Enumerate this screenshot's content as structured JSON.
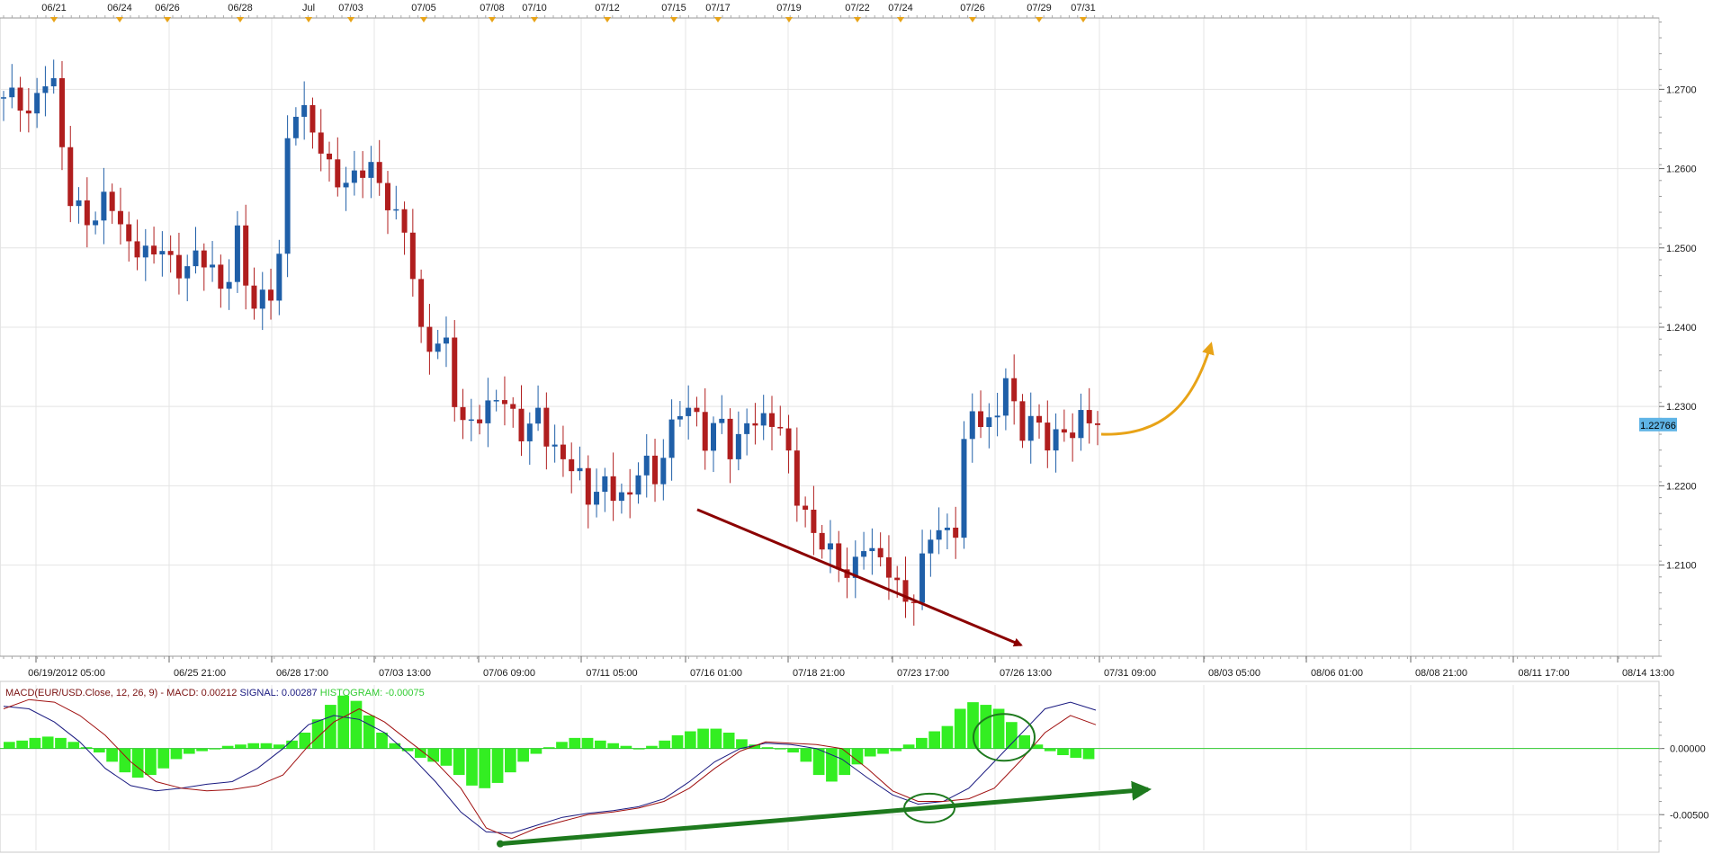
{
  "chart_data": [
    {
      "type": "candlestick",
      "instrument": "EUR/USD",
      "top_date_labels": [
        "06/21",
        "06/24",
        "06/26",
        "06/28",
        "Jul",
        "07/03",
        "07/05",
        "07/08",
        "07/10",
        "07/12",
        "07/15",
        "07/17",
        "07/19",
        "07/22",
        "07/24",
        "07/26",
        "07/29",
        "07/31"
      ],
      "bottom_time_labels": [
        "06/19/2012 05:00",
        "06/25 21:00",
        "06/28 17:00",
        "07/03 13:00",
        "07/06 09:00",
        "07/11 05:00",
        "07/16 01:00",
        "07/18 21:00",
        "07/23 17:00",
        "07/26 13:00",
        "07/31 09:00",
        "08/03 05:00",
        "08/06 01:00",
        "08/08 21:00",
        "08/11 17:00",
        "08/14 13:00"
      ],
      "y_ticks": [
        "1.2100",
        "1.2200",
        "1.2300",
        "1.2400",
        "1.2500",
        "1.2600",
        "1.2700"
      ],
      "ylim": [
        1.1985,
        1.279
      ],
      "last_price_label": "1.22766",
      "last_price": 1.22766,
      "colors": {
        "up": "#1f5fa8",
        "down": "#b01e1e",
        "grid": "#e4e4e4"
      },
      "close_path": [
        1.269,
        1.2695,
        1.266,
        1.2718,
        1.27,
        1.256,
        1.2545,
        1.253,
        1.2578,
        1.252,
        1.25,
        1.249,
        1.2505,
        1.2475,
        1.247,
        1.2498,
        1.247,
        1.244,
        1.252,
        1.242,
        1.244,
        1.245,
        1.268,
        1.2672,
        1.264,
        1.26,
        1.2578,
        1.259,
        1.2608,
        1.2575,
        1.254,
        1.252,
        1.239,
        1.2375,
        1.238,
        1.227,
        1.2285,
        1.229,
        1.232,
        1.229,
        1.226,
        1.2295,
        1.2245,
        1.2235,
        1.222,
        1.218,
        1.2205,
        1.219,
        1.218,
        1.224,
        1.2205,
        1.226,
        1.23,
        1.2295,
        1.225,
        1.2292,
        1.223,
        1.2285,
        1.2278,
        1.2285,
        1.226,
        1.218,
        1.2145,
        1.2125,
        1.2105,
        1.208,
        1.213,
        1.211,
        1.2095,
        1.2055,
        1.206,
        1.214,
        1.2145,
        1.213,
        1.2295,
        1.2285,
        1.227,
        1.2345,
        1.226,
        1.229,
        1.2255,
        1.2265,
        1.2268,
        1.229,
        1.2276
      ],
      "annotations": [
        {
          "type": "arrow",
          "color": "#8b0000",
          "from": [
            "07/12",
            1.217
          ],
          "to": [
            "07/27",
            1.199
          ]
        },
        {
          "type": "curved-arrow",
          "color": "#e8a317",
          "from": [
            "07/31",
            1.2265
          ],
          "to": [
            "08/03",
            1.239
          ]
        }
      ]
    },
    {
      "type": "macd",
      "label_prefix": "MACD(EUR/USD.Close, 12, 26, 9)",
      "macd_label": "MACD: 0.00212",
      "signal_label": "SIGNAL: 0.00287",
      "histogram_label": "HISTOGRAM: -0.00075",
      "y_ticks": [
        "0.00000",
        "-0.00500"
      ],
      "ylim": [
        -0.0077,
        0.0048
      ],
      "colors": {
        "macd": "#a01010",
        "signal": "#1a1a80",
        "histogram": "#33ee22",
        "zero_line": "#33cc33",
        "label_macd": "#7a1010",
        "label_signal": "#1a1a80",
        "label_hist": "#33cc33"
      },
      "histogram": [
        0.0005,
        0.0006,
        0.0008,
        0.0009,
        0.0008,
        0.0005,
        0.0001,
        -0.0003,
        -0.001,
        -0.0018,
        -0.0022,
        -0.002,
        -0.0015,
        -0.0008,
        -0.0004,
        -0.0002,
        0.0,
        0.0002,
        0.0003,
        0.0004,
        0.0004,
        0.0003,
        0.0006,
        0.0012,
        0.0022,
        0.0033,
        0.004,
        0.0036,
        0.0025,
        0.0012,
        0.0004,
        -0.0002,
        -0.0007,
        -0.001,
        -0.0013,
        -0.002,
        -0.0028,
        -0.003,
        -0.0026,
        -0.0018,
        -0.001,
        -0.0004,
        0.0001,
        0.0005,
        0.0008,
        0.0008,
        0.0006,
        0.0004,
        0.0002,
        0.0,
        0.0002,
        0.0006,
        0.001,
        0.0013,
        0.0015,
        0.0015,
        0.0012,
        0.0007,
        0.0003,
        0.0001,
        0.0,
        -0.0003,
        -0.001,
        -0.002,
        -0.0025,
        -0.002,
        -0.0012,
        -0.0006,
        -0.0004,
        -0.0002,
        0.0003,
        0.0008,
        0.0013,
        0.0017,
        0.003,
        0.0035,
        0.0033,
        0.003,
        0.002,
        0.001,
        0.0003,
        -0.0002,
        -0.0005,
        -0.0007,
        -0.0008
      ],
      "macd": [
        0.003,
        0.0037,
        0.0035,
        0.0025,
        0.001,
        -0.001,
        -0.0025,
        -0.003,
        -0.0032,
        -0.0031,
        -0.0028,
        -0.002,
        0.0002,
        0.002,
        0.003,
        0.002,
        0.0005,
        -0.001,
        -0.003,
        -0.006,
        -0.0068,
        -0.006,
        -0.0055,
        -0.005,
        -0.0048,
        -0.0045,
        -0.004,
        -0.003,
        -0.0015,
        -0.0002,
        0.0005,
        0.0004,
        0.0003,
        0.0,
        -0.0015,
        -0.0032,
        -0.004,
        -0.004,
        -0.0038,
        -0.003,
        -0.001,
        0.0012,
        0.0025,
        0.0018
      ],
      "signal": [
        0.0032,
        0.003,
        0.002,
        0.0005,
        -0.0015,
        -0.0028,
        -0.0032,
        -0.003,
        -0.0027,
        -0.0025,
        -0.0015,
        0.0,
        0.0018,
        0.0025,
        0.0022,
        0.0012,
        -0.0005,
        -0.0025,
        -0.0048,
        -0.0063,
        -0.0064,
        -0.0058,
        -0.0052,
        -0.0049,
        -0.0047,
        -0.0044,
        -0.0038,
        -0.0025,
        -0.001,
        0.0,
        0.0004,
        0.0003,
        0.0,
        -0.0008,
        -0.0022,
        -0.0035,
        -0.0042,
        -0.004,
        -0.003,
        -0.001,
        0.001,
        0.003,
        0.0035,
        0.0029
      ],
      "annotations": [
        {
          "type": "arrow",
          "color": "#1e7a1e",
          "from": [
            "07/09",
            -0.0072
          ],
          "to": [
            "08/03",
            -0.0035
          ]
        },
        {
          "type": "ellipse",
          "color": "#1e7a1e",
          "at": [
            "07/24",
            -0.0045
          ]
        },
        {
          "type": "ellipse",
          "color": "#1e7a1e",
          "at": [
            "07/27",
            0.0003
          ]
        }
      ]
    }
  ]
}
